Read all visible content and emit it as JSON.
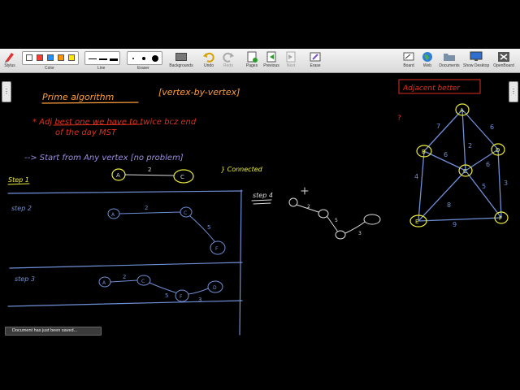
{
  "toolbar": {
    "stylus": "Stylus",
    "color": "Color",
    "line": "Line",
    "eraser": "Eraser",
    "backgrounds": "Backgrounds",
    "undo": "Undo",
    "redo": "Redo",
    "pages": "Pages",
    "previous": "Previous",
    "next": "Next",
    "erase": "Erase",
    "board": "Board",
    "web": "Web",
    "documents": "Documents",
    "show_desktop": "Show Desktop",
    "openboard": "OpenBoard"
  },
  "colors": {
    "palette": [
      "#ffffff",
      "#ff3b30",
      "#1e90ff",
      "#ff9500",
      "#ffe600"
    ],
    "chalk": "#dcdcdc",
    "red_ink": "#e0301e",
    "blue_ink": "#6f8fd8",
    "orange_ink": "#ff9d3a",
    "yellow_ink": "#ecec3a"
  },
  "board": {
    "title": "Prime algorithm",
    "subtitle": "[vertex-by-vertex]",
    "note_line1": "* Adj best one  we have to twice bcz end",
    "note_line2": "of the day MST",
    "note_line3": "--> Start from Any vertex [no problem]",
    "connected": "} Connected",
    "adjacent_better": "Adjacent better",
    "question_mark": "?",
    "step1": "Step 1",
    "step2": "step 2",
    "step3": "step 3",
    "step4": "step 4",
    "graph_nodes": [
      "A",
      "B",
      "C",
      "D",
      "E",
      "F"
    ],
    "edge_labels": [
      "7",
      "6",
      "2",
      "6",
      "6",
      "4",
      "5",
      "3",
      "8",
      "9"
    ]
  },
  "status": {
    "toast": "Document has just been saved..."
  }
}
